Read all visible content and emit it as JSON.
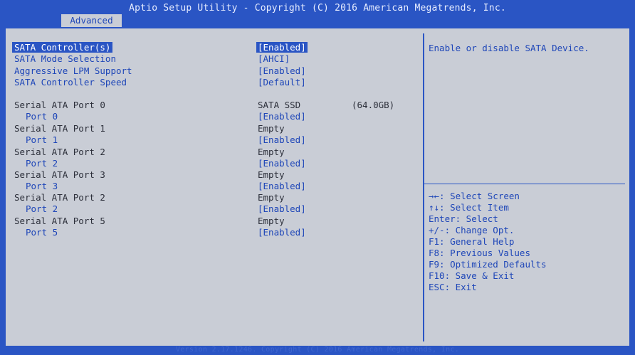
{
  "title": "Aptio Setup Utility - Copyright (C) 2016 American Megatrends, Inc.",
  "tab": "Advanced",
  "settings": [
    {
      "label": "SATA Controller(s)",
      "value": "[Enabled]"
    },
    {
      "label": "SATA Mode Selection",
      "value": "[AHCI]"
    },
    {
      "label": "Aggressive LPM Support",
      "value": "[Enabled]"
    },
    {
      "label": "SATA Controller Speed",
      "value": "[Default]"
    }
  ],
  "ports": [
    {
      "name": "Serial ATA Port 0",
      "device": "SATA SSD",
      "size": "(64.0GB)",
      "sub_label": "Port 0",
      "sub_value": "[Enabled]"
    },
    {
      "name": "Serial ATA Port 1",
      "device": "Empty",
      "size": "",
      "sub_label": "Port 1",
      "sub_value": "[Enabled]"
    },
    {
      "name": "Serial ATA Port 2",
      "device": "Empty",
      "size": "",
      "sub_label": "Port 2",
      "sub_value": "[Enabled]"
    },
    {
      "name": "Serial ATA Port 3",
      "device": "Empty",
      "size": "",
      "sub_label": "Port 3",
      "sub_value": "[Enabled]"
    },
    {
      "name": "Serial ATA Port 2",
      "device": "Empty",
      "size": "",
      "sub_label": "Port 2",
      "sub_value": "[Enabled]"
    },
    {
      "name": "Serial ATA Port 5",
      "device": "Empty",
      "size": "",
      "sub_label": "Port 5",
      "sub_value": "[Enabled]"
    }
  ],
  "help": "Enable or disable SATA Device.",
  "keys": [
    "→←: Select Screen",
    "↑↓: Select Item",
    "Enter: Select",
    "+/-: Change Opt.",
    "F1: General Help",
    "F8: Previous Values",
    "F9: Optimized Defaults",
    "F10: Save & Exit",
    "ESC: Exit"
  ],
  "footer": "Version 2.17.1246. Copyright (C) 2016 American Megatrends, Inc.",
  "colors": {
    "background": "#2a55c4",
    "panel": "#c9cdd6",
    "accent_text": "#1e46b8",
    "plain_text": "#2c2f3a",
    "highlight_text": "#ffffff"
  }
}
